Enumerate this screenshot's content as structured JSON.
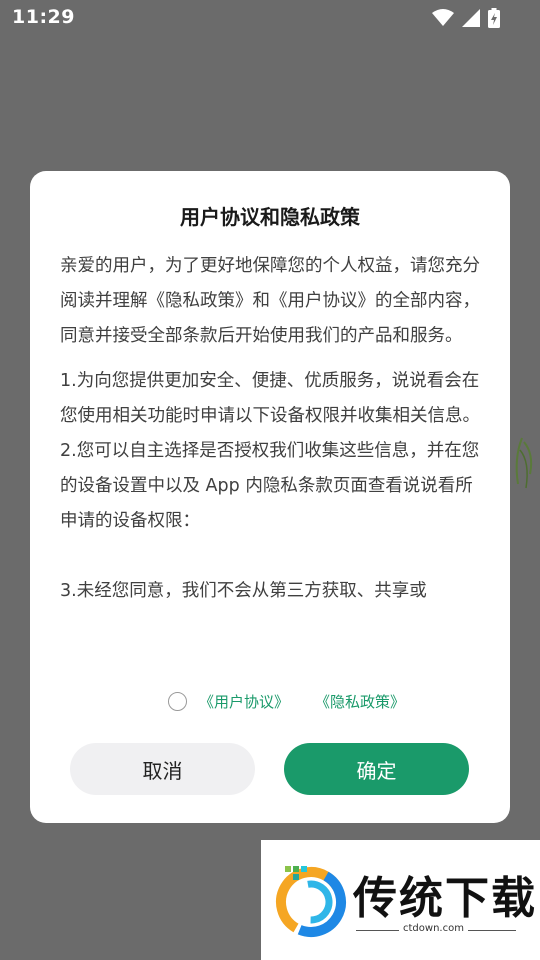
{
  "status_bar": {
    "time": "11:29",
    "icons": [
      "wifi-icon",
      "signal-icon",
      "battery-charging-icon"
    ]
  },
  "dialog": {
    "title": "用户协议和隐私政策",
    "intro": "亲爱的用户，为了更好地保障您的个人权益，请您充分阅读并理解《隐私政策》和《用户协议》的全部内容，同意并接受全部条款后开始使用我们的产品和服务。",
    "item1": "1.为向您提供更加安全、便捷、优质服务，说说看会在您使用相关功能时申请以下设备权限并收集相关信息。",
    "item2": "2.您可以自主选择是否授权我们收集这些信息，并在您的设备设置中以及 App 内隐私条款页面查看说说看所申请的设备权限：",
    "item3": "3.未经您同意，我们不会从第三方获取、共享或",
    "agree_checked": false,
    "link_user_agreement": "《用户协议》",
    "link_privacy_policy": "《隐私政策》",
    "cancel_label": "取消",
    "confirm_label": "确定"
  },
  "watermark": {
    "brand": "传统下载",
    "url": "ctdown.com"
  },
  "colors": {
    "accent": "#1a9a6a",
    "overlay": "#6b6b6b"
  }
}
